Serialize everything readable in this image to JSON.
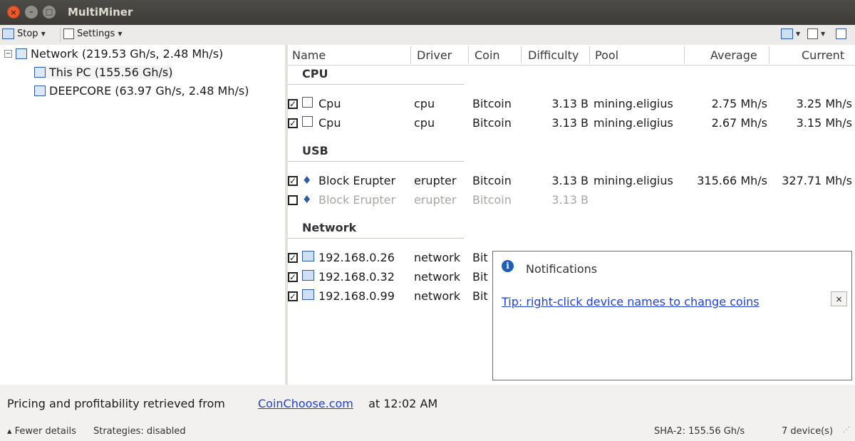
{
  "window": {
    "title": "MultiMiner"
  },
  "toolbar": {
    "stop_label": "Stop",
    "settings_label": "Settings"
  },
  "tree": {
    "root": "Network (219.53 Gh/s, 2.48 Mh/s)",
    "children": [
      "This PC (155.56 Gh/s)",
      "DEEPCORE (63.97 Gh/s, 2.48 Mh/s)"
    ]
  },
  "columns": [
    "Name",
    "Driver",
    "Coin",
    "Difficulty",
    "Pool",
    "Average",
    "Current"
  ],
  "groups": {
    "cpu": {
      "label": "CPU",
      "rows": [
        {
          "name": "Cpu",
          "driver": "cpu",
          "coin": "Bitcoin",
          "difficulty": "3.13 B",
          "pool": "mining.eligius",
          "average": "2.75 Mh/s",
          "current": "3.25 Mh/s"
        },
        {
          "name": "Cpu",
          "driver": "cpu",
          "coin": "Bitcoin",
          "difficulty": "3.13 B",
          "pool": "mining.eligius",
          "average": "2.67 Mh/s",
          "current": "3.15 Mh/s"
        }
      ]
    },
    "usb": {
      "label": "USB",
      "rows": [
        {
          "name": "Block Erupter",
          "driver": "erupter",
          "coin": "Bitcoin",
          "difficulty": "3.13 B",
          "pool": "mining.eligius",
          "average": "315.66 Mh/s",
          "current": "327.71 Mh/s"
        },
        {
          "name": "Block Erupter",
          "driver": "erupter",
          "coin": "Bitcoin",
          "difficulty": "3.13 B",
          "pool": "",
          "average": "",
          "current": ""
        }
      ]
    },
    "network": {
      "label": "Network",
      "rows": [
        {
          "name": "192.168.0.26",
          "driver": "network",
          "coin": "Bit"
        },
        {
          "name": "192.168.0.32",
          "driver": "network",
          "coin": "Bit"
        },
        {
          "name": "192.168.0.99",
          "driver": "network",
          "coin": "Bit"
        }
      ]
    }
  },
  "notification": {
    "title": "Notifications",
    "tip": "Tip: right-click device names to change coins",
    "close": "×"
  },
  "info": {
    "prefix": "Pricing and profitability retrieved from ",
    "link": "CoinChoose.com",
    "suffix": " at 12:02 AM"
  },
  "status": {
    "fewer_details": "▴ Fewer details",
    "strategies": "Strategies: disabled",
    "hashrate": "SHA-2: 155.56 Gh/s",
    "devices": "7 device(s)"
  }
}
